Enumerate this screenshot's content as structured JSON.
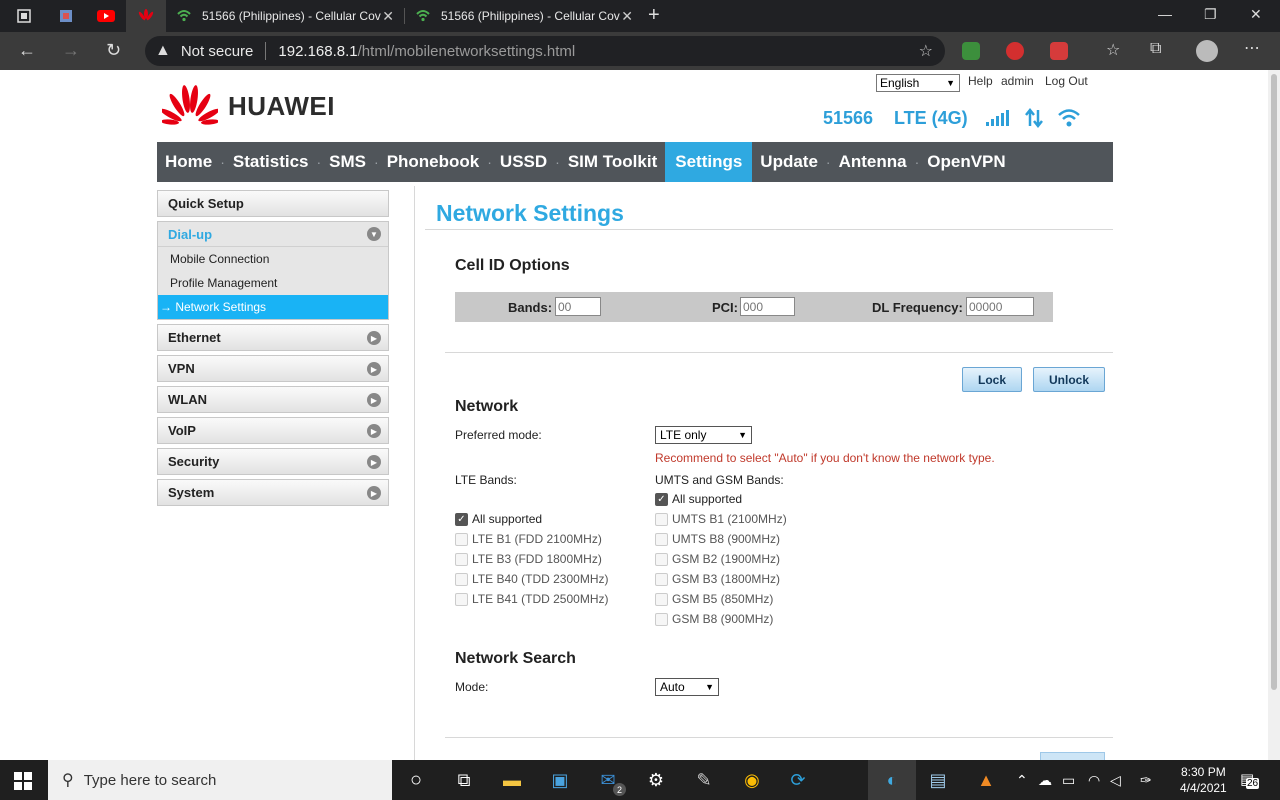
{
  "browser": {
    "tabs": [
      {
        "title": "51566 (Philippines) - Cellular Cov"
      },
      {
        "title": "51566 (Philippines) - Cellular Cov"
      }
    ],
    "close_glyph": "✕",
    "new_tab_glyph": "+",
    "not_secure": "Not secure",
    "url_host": "192.168.8.1",
    "url_path": "/html/mobilenetworksettings.html"
  },
  "header": {
    "language": "English",
    "help": "Help",
    "user": "admin",
    "logout": "Log Out",
    "brand": "HUAWEI",
    "operator": "51566",
    "network_type": "LTE (4G)"
  },
  "nav": [
    "Home",
    "Statistics",
    "SMS",
    "Phonebook",
    "USSD",
    "SIM Toolkit",
    "Settings",
    "Update",
    "Antenna",
    "OpenVPN"
  ],
  "sidebar": {
    "quick_setup": "Quick Setup",
    "dialup": "Dial-up",
    "dialup_items": [
      "Mobile Connection",
      "Profile Management",
      "→ Network Settings"
    ],
    "sections": [
      "Ethernet",
      "VPN",
      "WLAN",
      "VoIP",
      "Security",
      "System"
    ]
  },
  "main": {
    "title": "Network Settings",
    "cell_id": {
      "heading": "Cell ID Options",
      "bands_label": "Bands:",
      "bands_placeholder": "00",
      "pci_label": "PCI:",
      "pci_placeholder": "000",
      "dl_label": "DL Frequency:",
      "dl_placeholder": "00000"
    },
    "lock": "Lock",
    "unlock": "Unlock",
    "network": {
      "heading": "Network",
      "preferred_label": "Preferred mode:",
      "preferred_value": "LTE only",
      "note": "Recommend to select \"Auto\" if you don't know the network type.",
      "lte_label": "LTE Bands:",
      "umts_label": "UMTS and GSM Bands:",
      "lte_bands": [
        {
          "label": "All supported",
          "checked": true
        },
        {
          "label": "LTE B1 (FDD 2100MHz)",
          "checked": false
        },
        {
          "label": "LTE B3 (FDD 1800MHz)",
          "checked": false
        },
        {
          "label": "LTE B40 (TDD 2300MHz)",
          "checked": false
        },
        {
          "label": "LTE B41 (TDD 2500MHz)",
          "checked": false
        }
      ],
      "umts_bands": [
        {
          "label": "All supported",
          "checked": true
        },
        {
          "label": "UMTS B1 (2100MHz)",
          "checked": false
        },
        {
          "label": "UMTS B8 (900MHz)",
          "checked": false
        },
        {
          "label": "GSM B2 (1900MHz)",
          "checked": false
        },
        {
          "label": "GSM B3 (1800MHz)",
          "checked": false
        },
        {
          "label": "GSM B5 (850MHz)",
          "checked": false
        },
        {
          "label": "GSM B8 (900MHz)",
          "checked": false
        }
      ]
    },
    "search": {
      "heading": "Network Search",
      "mode_label": "Mode:",
      "mode_value": "Auto"
    }
  },
  "taskbar": {
    "search_placeholder": "Type here to search",
    "mail_badge": "2",
    "time": "8:30 PM",
    "date": "4/4/2021",
    "notifications": "26"
  },
  "colors": {
    "accent": "#2fa9e1",
    "nav_bg": "#50555a",
    "note": "#c0392b",
    "brand_red": "#e60012"
  }
}
